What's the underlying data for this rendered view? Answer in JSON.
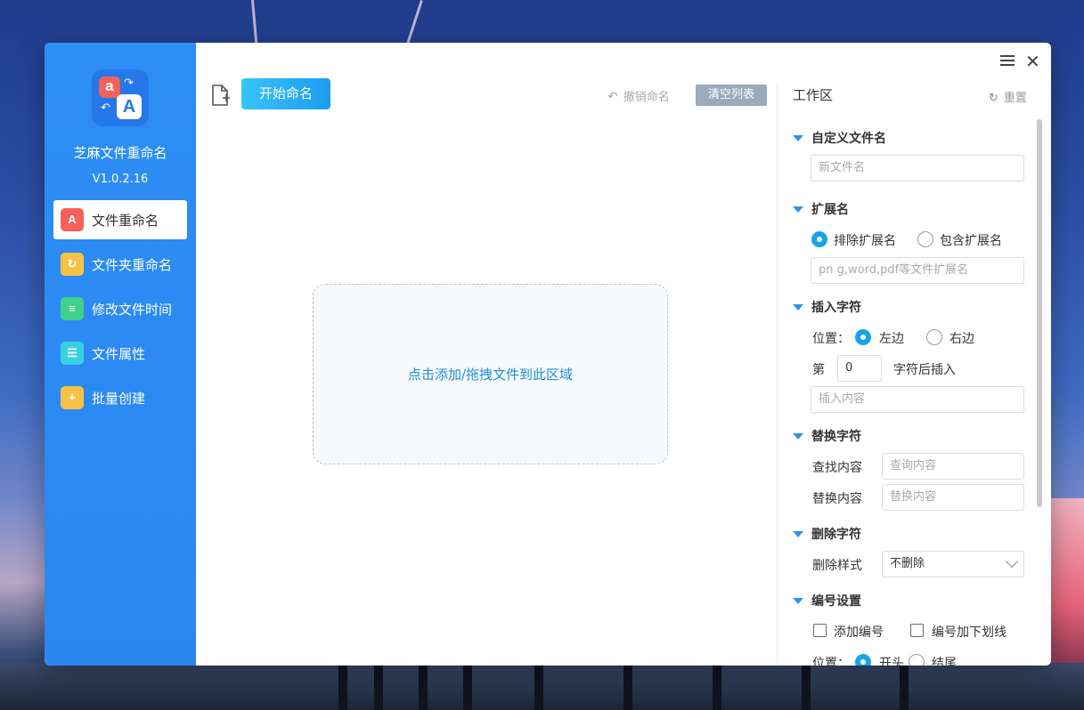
{
  "sidebar": {
    "app_name": "芝麻文件重命名",
    "version": "V1.0.2.16",
    "items": [
      {
        "label": "文件重命名",
        "icon": "file-rename-icon"
      },
      {
        "label": "文件夹重命名",
        "icon": "folder-rename-icon"
      },
      {
        "label": "修改文件时间",
        "icon": "file-time-icon"
      },
      {
        "label": "文件属性",
        "icon": "file-attribute-icon"
      },
      {
        "label": "批量创建",
        "icon": "batch-create-icon"
      }
    ]
  },
  "toolbar": {
    "start_label": "开始命名",
    "undo_label": "撤销命名",
    "clear_label": "清空列表"
  },
  "main": {
    "drop_text": "点击添加/拖拽文件到此区域"
  },
  "panel": {
    "title": "工作区",
    "reset_label": "重置",
    "custom_name": {
      "title": "自定义文件名",
      "placeholder": "新文件名"
    },
    "extension": {
      "title": "扩展名",
      "option_exclude": "排除扩展名",
      "option_include": "包含扩展名",
      "selected": "排除扩展名",
      "placeholder": "pn g,word,pdf等文件扩展名"
    },
    "insert": {
      "title": "插入字符",
      "position_label": "位置：",
      "option_left": "左边",
      "option_right": "右边",
      "selected": "左边",
      "prefix_label": "第",
      "index_value": "0",
      "suffix_label": "字符后插入",
      "content_placeholder": "插入内容"
    },
    "replace": {
      "title": "替换字符",
      "find_label": "查找内容",
      "find_placeholder": "查询内容",
      "replace_label": "替换内容",
      "replace_placeholder": "替换内容"
    },
    "delete": {
      "title": "删除字符",
      "style_label": "删除样式",
      "style_value": "不删除"
    },
    "numbering": {
      "title": "编号设置",
      "add_number_label": "添加编号",
      "underline_label": "编号加下划线",
      "position_label": "位置：",
      "option_start": "开头",
      "option_end": "结尾"
    }
  },
  "colors": {
    "sidebar": "#2a87f0",
    "accent": "#17a5ea",
    "drop_text": "#1e90d6"
  }
}
